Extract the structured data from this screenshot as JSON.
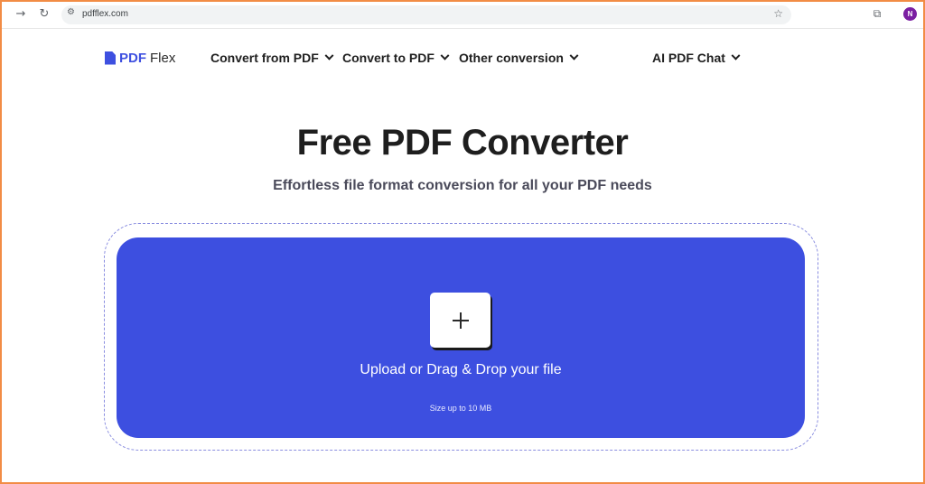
{
  "browser": {
    "url": "pdfflex.com",
    "profile_initial": "N",
    "icons": {
      "back": "arrow-right-icon",
      "reload": "reload-icon",
      "site_settings": "tune-icon",
      "bookmark": "star-icon",
      "extensions": "puzzle-icon"
    }
  },
  "header": {
    "logo_pdf": "PDF",
    "logo_flex": "Flex",
    "nav": [
      {
        "label": "Convert from PDF"
      },
      {
        "label": "Convert to PDF"
      },
      {
        "label": "Other conversion"
      },
      {
        "label": "AI PDF Chat"
      }
    ]
  },
  "hero": {
    "title": "Free PDF Converter",
    "subtitle": "Effortless file format conversion for all your PDF needs"
  },
  "upload": {
    "label": "Upload or Drag & Drop your file",
    "size_note": "Size up to 10 MB"
  },
  "colors": {
    "accent": "#3d4fe0",
    "frame_border": "#f28c45",
    "profile": "#7b1fa2"
  }
}
